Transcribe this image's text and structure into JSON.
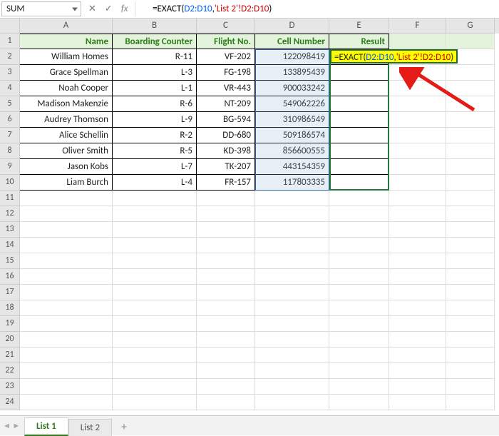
{
  "formula_bar": {
    "namebox": "SUM",
    "cancel": "✕",
    "accept": "✓",
    "fx": "fx",
    "formula_plain": "=EXACT(D2:D10,'List 2'!D2:D10)"
  },
  "columns": [
    "A",
    "B",
    "C",
    "D",
    "E",
    "F",
    "G"
  ],
  "row_numbers": [
    "1",
    "2",
    "3",
    "4",
    "5",
    "6",
    "7",
    "8",
    "9",
    "10",
    "11",
    "12",
    "13",
    "14",
    "15",
    "16",
    "17",
    "18",
    "19",
    "20",
    "21",
    "22",
    "23",
    "24"
  ],
  "headers": {
    "A": "Name",
    "B": "Boarding Counter",
    "C": "Flight No.",
    "D": "Cell Number",
    "E": "Result"
  },
  "rows": [
    {
      "A": "William Homes",
      "B": "R-11",
      "C": "VF-202",
      "D": "122098419"
    },
    {
      "A": "Grace Spellman",
      "B": "L-3",
      "C": "FG-198",
      "D": "133895439"
    },
    {
      "A": "Noah Cooper",
      "B": "L-1",
      "C": "VR-443",
      "D": "900033242"
    },
    {
      "A": "Madison Makenzie",
      "B": "R-6",
      "C": "NT-209",
      "D": "549062226"
    },
    {
      "A": "Audrey Thomson",
      "B": "L-9",
      "C": "BG-594",
      "D": "310986549"
    },
    {
      "A": "Alice Schellin",
      "B": "R-2",
      "C": "DD-680",
      "D": "509186574"
    },
    {
      "A": "Oliver Smith",
      "B": "R-5",
      "C": "KD-398",
      "D": "856600555"
    },
    {
      "A": "Jason Kobs",
      "B": "L-7",
      "C": "TK-207",
      "D": "443154359"
    },
    {
      "A": "Liam Burch",
      "B": "L-4",
      "C": "FR-157",
      "D": "117803335"
    }
  ],
  "editing_cell": {
    "value": "=EXACT(D2:D10,'List 2'!D2:D10)"
  },
  "tabs": {
    "active": "List 1",
    "other": "List 2",
    "new": "+"
  }
}
